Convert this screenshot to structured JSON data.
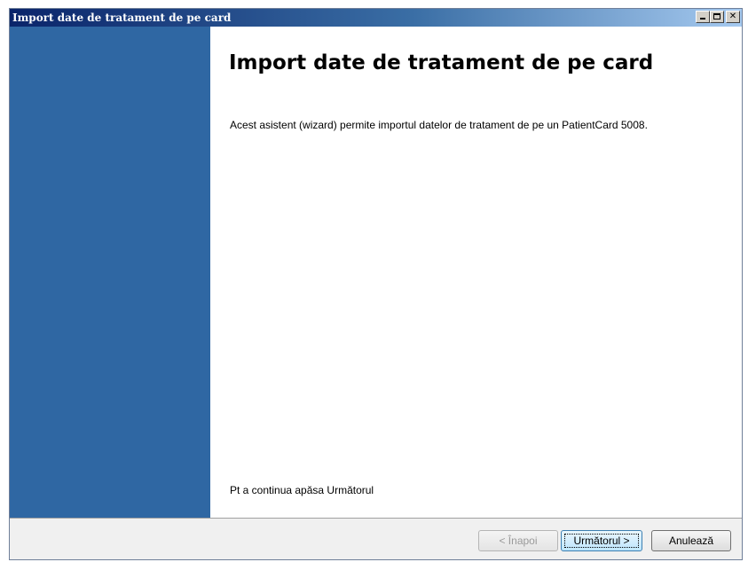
{
  "window": {
    "title": "Import date de tratament de pe card"
  },
  "main": {
    "heading": "Import date de tratament de pe card",
    "description": "Acest asistent (wizard) permite importul datelor de tratament de pe un PatientCard 5008.",
    "hint": "Pt a continua apăsa Următorul"
  },
  "buttons": {
    "back": "< Înapoi",
    "next": "Următorul >",
    "cancel": "Anulează"
  },
  "colors": {
    "sidebar": "#2f67a3",
    "titlebar_start": "#0a246a",
    "titlebar_end": "#a6caf0"
  },
  "icons": {
    "minimize": "minimize-icon",
    "maximize": "maximize-icon",
    "close": "close-icon"
  }
}
